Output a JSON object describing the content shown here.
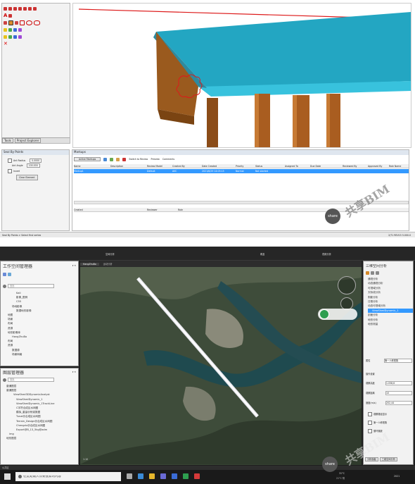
{
  "top_app": {
    "tabs": [
      "Tools",
      "Project Explorer"
    ],
    "markup_panel_title": "Markups",
    "search_panel_title": "Seal By Points",
    "search_options": {
      "auto_update_label": "Ant Radius",
      "auto_update_value": "0.0000",
      "angle_label": "Ant Angle",
      "angle_value": "100.000",
      "invert_label": "Invert",
      "button": "Clear Element"
    },
    "markup_toolbar": [
      "Active Markups",
      "Switch to Review",
      "Preview",
      "Comments"
    ],
    "markup_columns": [
      "Name",
      "Description",
      "Review Model",
      "Created By",
      "Date Created",
      "Priority",
      "Status",
      "Assigned To",
      "Due Date",
      "Reviewed By",
      "Approved By",
      "Role Name"
    ],
    "markup_row": [
      "Markup1",
      "",
      "Default",
      "AVC",
      "2021/6/29 14:03:15",
      "Normal",
      "Not started",
      "",
      "",
      "",
      "",
      ""
    ],
    "comment_columns": [
      "Created",
      "Reviewer",
      "Role"
    ],
    "status_left": "Seal By Points > Select first vertex",
    "status_right": "2/71 REV15 5.000.0",
    "watermark": "共享BIM",
    "share_badge": "share"
  },
  "bottom_app": {
    "top_menu": [
      "空间分析",
      "覆盖",
      "视频分析"
    ],
    "workspace_title": "工作空间管理器",
    "search_placeholder": "查找",
    "workspace_tree": [
      "Kali",
      "影像_图例",
      "C55",
      "场地影像",
      "数据地形影像",
      "地图",
      "场景",
      "布局",
      "资源",
      "地形影像库",
      "HangZhuBo",
      "布局",
      "资源",
      "数据源",
      "场景网格"
    ],
    "layer_title": "图层管理器",
    "layer_tree": [
      "普通图层",
      "普通图层",
      "ViewShed3DDynamicAnalyst",
      "ViewShedDynamic_1",
      "ViewShedDynamic_1TrackLine",
      "C字符合成区水网图",
      "模拟_重量@桥梁数据",
      "Tunal@合成区水网图",
      "Terrain_Design@合成区水网图",
      "Chengdu@合成区水网图",
      "Export@B_13_5kg@adm",
      "img",
      "地形图层"
    ],
    "map_tabs": [
      "HangZhuBo",
      "运动分析"
    ],
    "right_panel_title": "三维空间分析",
    "right_tree": [
      "通视分析",
      "动态通视分析",
      "可视域分析",
      "天际线分析",
      "阴影分析",
      "日照分析",
      "动态可视域分析",
      "ViewShedDynamic_1",
      "剖面分析",
      "地形分析",
      "地形测量"
    ],
    "attr_label": "属性",
    "attr_value": "第一人称视角",
    "params_title": "操作设置",
    "params": [
      {
        "label": "观察高度",
        "value": "1.058,6"
      },
      {
        "label": "观察距离",
        "value": "10"
      },
      {
        "label": "速度(m/s)",
        "value": "202,44"
      }
    ],
    "checks": [
      "观察路径显示",
      "第一人称视角",
      "循环播放"
    ],
    "right_bottom_tabs": [
      "分析面板",
      "三维空间分析"
    ],
    "scale_label": "1:10",
    "status_label": "公共区",
    "taskbar_search": "在此处输入你要搜索的内容",
    "weather_temp": "31°C",
    "weather_desc": "21°C 阴",
    "clock": "2021",
    "watermark": "共享BIM",
    "share_badge": "share"
  }
}
